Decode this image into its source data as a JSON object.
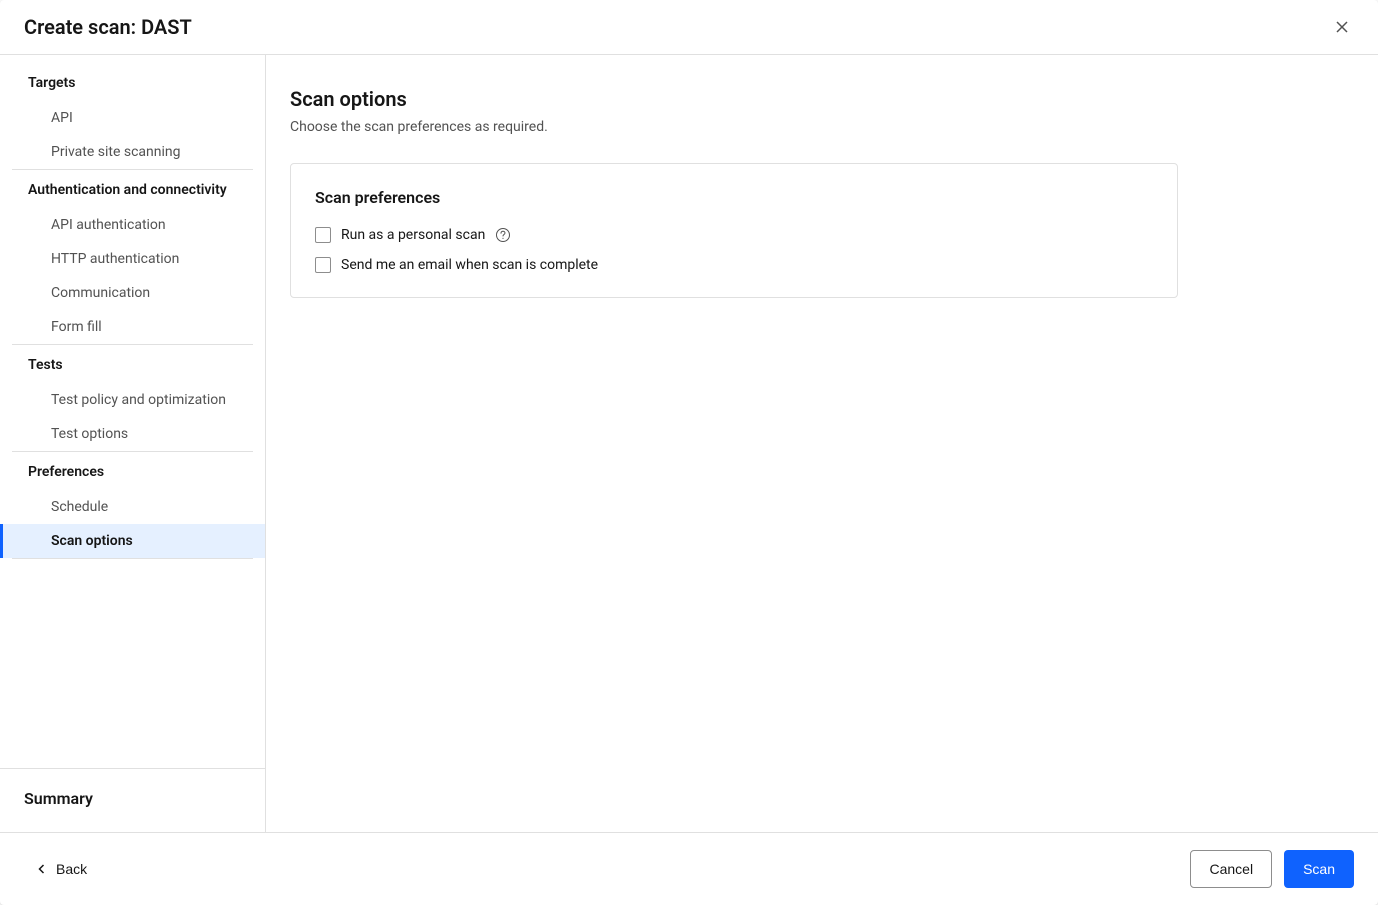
{
  "header": {
    "title": "Create scan: DAST"
  },
  "sidebar": {
    "sections": [
      {
        "title": "Targets",
        "items": [
          {
            "label": "API",
            "active": false
          },
          {
            "label": "Private site scanning",
            "active": false
          }
        ]
      },
      {
        "title": "Authentication and connectivity",
        "items": [
          {
            "label": "API authentication",
            "active": false
          },
          {
            "label": "HTTP authentication",
            "active": false
          },
          {
            "label": "Communication",
            "active": false
          },
          {
            "label": "Form fill",
            "active": false
          }
        ]
      },
      {
        "title": "Tests",
        "items": [
          {
            "label": "Test policy and optimization",
            "active": false
          },
          {
            "label": "Test options",
            "active": false
          }
        ]
      },
      {
        "title": "Preferences",
        "items": [
          {
            "label": "Schedule",
            "active": false
          },
          {
            "label": "Scan options",
            "active": true
          }
        ]
      }
    ],
    "summary_label": "Summary"
  },
  "main": {
    "title": "Scan options",
    "subtitle": "Choose the scan preferences as required.",
    "card_title": "Scan preferences",
    "checkbox1_label": "Run as a personal scan",
    "checkbox2_label": "Send me an email when scan is complete"
  },
  "footer": {
    "back_label": "Back",
    "cancel_label": "Cancel",
    "scan_label": "Scan"
  }
}
